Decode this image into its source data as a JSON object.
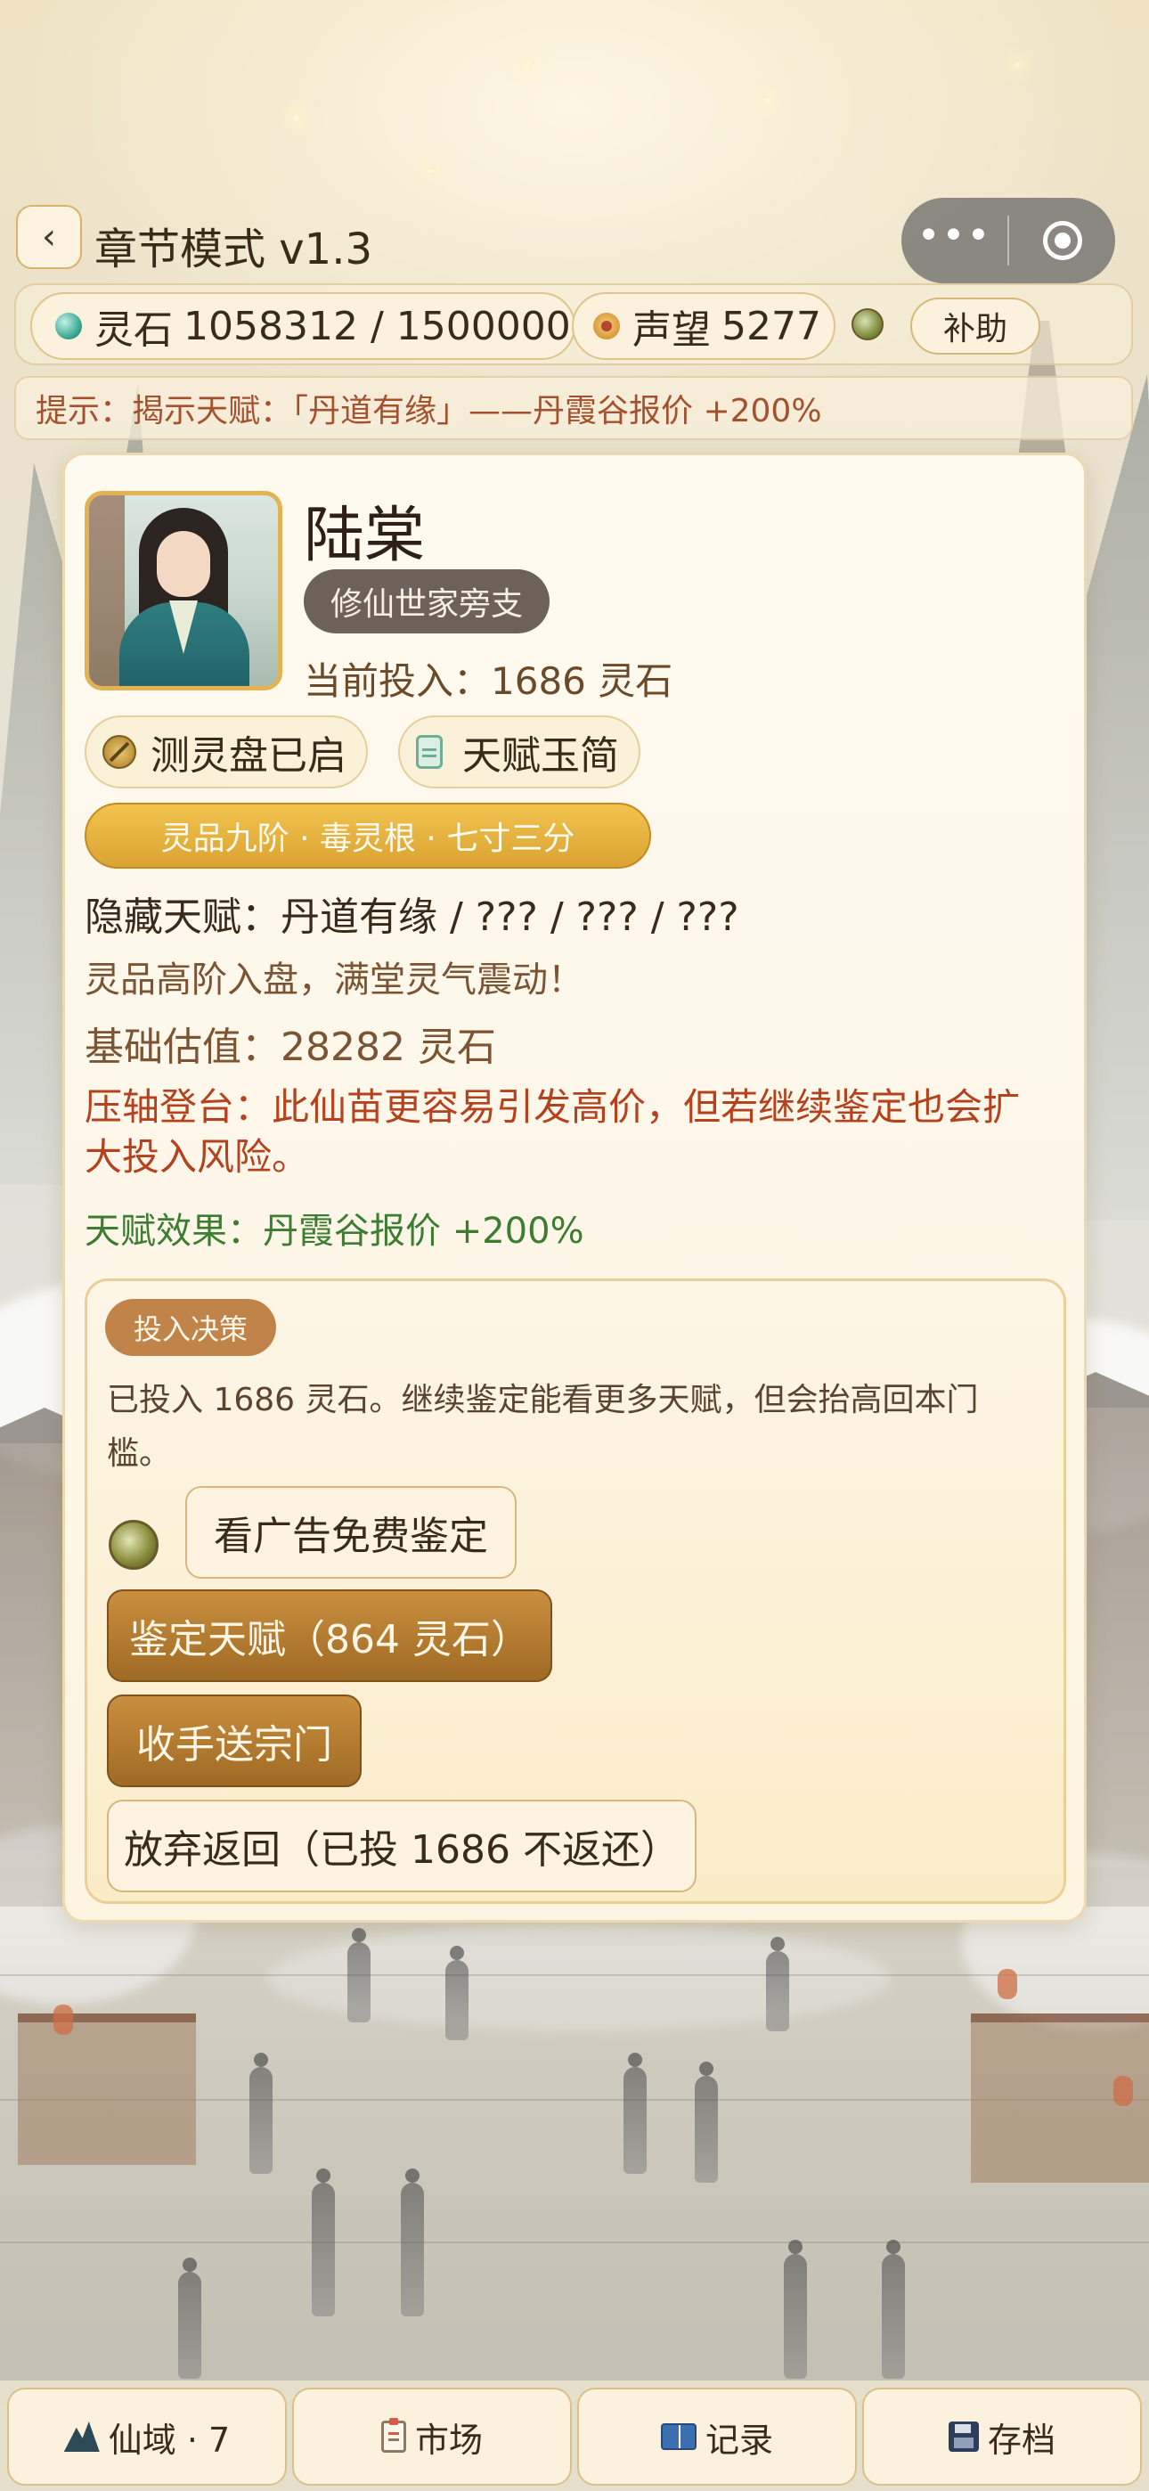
{
  "header": {
    "back_label": "‹",
    "title": "章节模式 v1.3",
    "capsule_more_icon": "more-dots-icon",
    "capsule_close_icon": "target-ring-icon"
  },
  "stats": {
    "spirit_stone_label": "灵石",
    "spirit_stone_value": "1058312 / 1500000",
    "prestige_label": "声望",
    "prestige_value": "5277",
    "subsidy_label": "补助"
  },
  "hint": {
    "text": "提示：揭示天赋：「丹道有缘」——丹霞谷报价 +200%"
  },
  "character": {
    "name": "陆棠",
    "origin": "修仙世家旁支",
    "investment": "当前投入：1686 灵石",
    "chip_compass": "测灵盘已启",
    "chip_scroll": "天赋玉简",
    "grade": "灵品九阶 · 毒灵根 · 七寸三分",
    "hidden_talents": "隐藏天赋：丹道有缘 / ??? / ??? / ???",
    "reaction": "灵品高阶入盘，满堂灵气震动！",
    "base_value": "基础估值：28282 灵石",
    "warning": "压轴登台：此仙苗更容易引发高价，但若继续鉴定也会扩大投入风险。",
    "effect": "天赋效果：丹霞谷报价 +200%"
  },
  "decision": {
    "tag": "投入决策",
    "description": "已投入 1686 灵石。继续鉴定能看更多天赋，但会抬高回本门槛。",
    "ad_button": "看广告免费鉴定",
    "appraise_button": "鉴定天赋（864 灵石）",
    "sect_button": "收手送宗门",
    "abandon_button": "放弃返回（已投 1686 不返还）"
  },
  "nav": {
    "realm": "仙域 · 7",
    "market": "市场",
    "records": "记录",
    "save": "存档"
  },
  "colors": {
    "accent_gold": "#dba332",
    "brown_button": "#9f6a24",
    "warning_text": "#b4421f",
    "effect_text": "#3c7d31",
    "hint_text": "#a3512e"
  }
}
